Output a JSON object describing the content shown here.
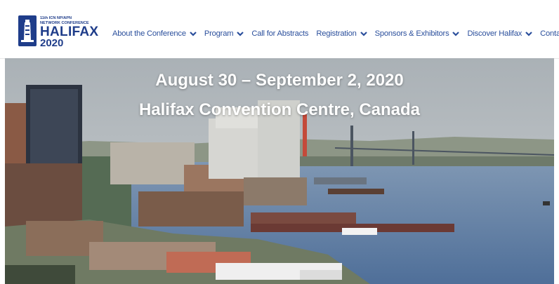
{
  "logo": {
    "line1": "11th ICN NP/APN",
    "line2": "NETWORK CONFERENCE",
    "line3": "HALIFAX",
    "line4": "2020",
    "icon": "lighthouse-icon"
  },
  "nav": [
    {
      "label": "About the Conference",
      "dropdown": true
    },
    {
      "label": "Program",
      "dropdown": true
    },
    {
      "label": "Call for Abstracts",
      "dropdown": false
    },
    {
      "label": "Registration",
      "dropdown": true
    },
    {
      "label": "Sponsors & Exhibitors",
      "dropdown": true
    },
    {
      "label": "Discover Halifax",
      "dropdown": true
    },
    {
      "label": "Contact Us",
      "dropdown": false
    }
  ],
  "hero": {
    "line1": "August 30 – September 2, 2020",
    "line2": "Halifax Convention Centre, Canada"
  },
  "colors": {
    "brand": "#1f3d8a",
    "nav": "#2b4f9c",
    "water": "#5f7fa6"
  }
}
